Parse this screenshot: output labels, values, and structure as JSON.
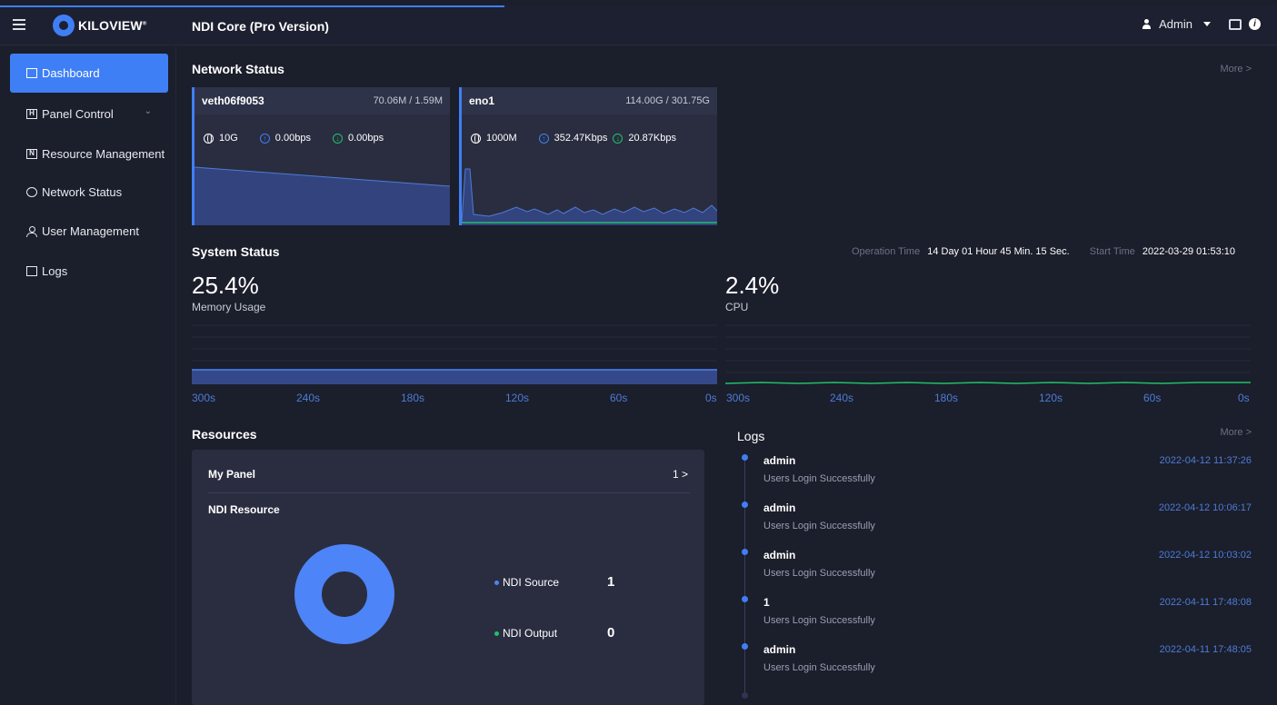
{
  "header": {
    "logo_text": "KILOVIEW",
    "logo_reg": "®",
    "app_title": "NDI Core (Pro Version)",
    "user": "Admin",
    "info_glyph": "i"
  },
  "sidebar": {
    "items": [
      {
        "label": "Dashboard",
        "icon": "layout-icon",
        "glyph": ""
      },
      {
        "label": "Panel Control",
        "icon": "panel-icon",
        "glyph": "H"
      },
      {
        "label": "Resource Management",
        "icon": "ndi-icon",
        "glyph": "N"
      },
      {
        "label": "Network Status",
        "icon": "globe-icon",
        "glyph": ""
      },
      {
        "label": "User Management",
        "icon": "user-icon",
        "glyph": ""
      },
      {
        "label": "Logs",
        "icon": "document-icon",
        "glyph": ""
      }
    ]
  },
  "network": {
    "title": "Network Status",
    "more": "More >",
    "cards": [
      {
        "name": "veth06f9053",
        "total": "70.06M / 1.59M",
        "speed": "10G",
        "up": "0.00bps",
        "down": "0.00bps"
      },
      {
        "name": "eno1",
        "total": "114.00G / 301.75G",
        "speed": "1000M",
        "up": "352.47Kbps",
        "down": "20.87Kbps"
      }
    ]
  },
  "system": {
    "title": "System Status",
    "operation_label": "Operation Time",
    "operation_value": "14 Day 01 Hour 45 Min. 15 Sec.",
    "start_label": "Start Time",
    "start_value": "2022-03-29 01:53:10",
    "memory_value": "25.4%",
    "memory_label": "Memory Usage",
    "cpu_value": "2.4%",
    "cpu_label": "CPU",
    "x_ticks": [
      "300s",
      "240s",
      "180s",
      "120s",
      "60s",
      "0s"
    ]
  },
  "resources": {
    "title": "Resources",
    "my_panel": "My Panel",
    "my_panel_count": "1 >",
    "ndi_resource": "NDI Resource",
    "legend": [
      {
        "label": "NDI Source",
        "value": "1",
        "color": "#4d84f7"
      },
      {
        "label": "NDI Output",
        "value": "0",
        "color": "#20c06a"
      }
    ]
  },
  "logs": {
    "title": "Logs",
    "more": "More >",
    "entries": [
      {
        "user": "admin",
        "message": "Users Login Successfully",
        "time": "2022-04-12 11:37:26"
      },
      {
        "user": "admin",
        "message": "Users Login Successfully",
        "time": "2022-04-12 10:06:17"
      },
      {
        "user": "admin",
        "message": "Users Login Successfully",
        "time": "2022-04-12 10:03:02"
      },
      {
        "user": "1",
        "message": "Users Login Successfully",
        "time": "2022-04-11 17:48:08"
      },
      {
        "user": "admin",
        "message": "Users Login Successfully",
        "time": "2022-04-11 17:48:05"
      }
    ]
  },
  "colors": {
    "accent": "#3f7ff5",
    "green": "#20c06a",
    "background": "#1b1e2b",
    "card": "#2a2d40"
  }
}
